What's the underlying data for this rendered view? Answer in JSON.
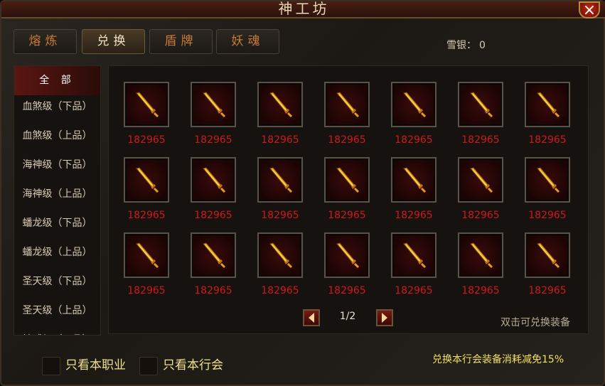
{
  "window": {
    "title": "神工坊",
    "close_label": "×"
  },
  "tabs": [
    {
      "label": "熔炼",
      "active": false
    },
    {
      "label": "兑换",
      "active": true
    },
    {
      "label": "盾牌",
      "active": false
    },
    {
      "label": "妖魂",
      "active": false
    }
  ],
  "currency": {
    "label": "雪银：",
    "value": "0"
  },
  "categories": [
    {
      "label": "全 部",
      "active": true
    },
    {
      "label": "血煞级（下品）",
      "active": false
    },
    {
      "label": "血煞级（上品）",
      "active": false
    },
    {
      "label": "海神级（下品）",
      "active": false
    },
    {
      "label": "海神级（上品）",
      "active": false
    },
    {
      "label": "蟠龙级（下品）",
      "active": false
    },
    {
      "label": "蟠龙级（上品）",
      "active": false
    },
    {
      "label": "圣天级（下品）",
      "active": false
    },
    {
      "label": "圣天级（上品）",
      "active": false
    },
    {
      "label": "神威级（下品）",
      "active": false
    }
  ],
  "items": [
    [
      "182965",
      "182965",
      "182965",
      "182965",
      "182965",
      "182965",
      "182965"
    ],
    [
      "182965",
      "182965",
      "182965",
      "182965",
      "182965",
      "182965",
      "182965"
    ],
    [
      "182965",
      "182965",
      "182965",
      "182965",
      "182965",
      "182965",
      "182965"
    ]
  ],
  "item_icon": "golden-sword-icon",
  "pager": {
    "current": "1/2",
    "prev_icon": "arrow-left-icon",
    "next_icon": "arrow-right-icon"
  },
  "hint": "双击可兑换装备",
  "filters": [
    {
      "label": "只看本职业",
      "checked": false
    },
    {
      "label": "只看本行会",
      "checked": false
    }
  ],
  "bonus_text": "兑换本行会装备消耗减免15%",
  "colors": {
    "price": "#d01818",
    "accent": "#c87a34",
    "bonus": "#f0e05a"
  }
}
